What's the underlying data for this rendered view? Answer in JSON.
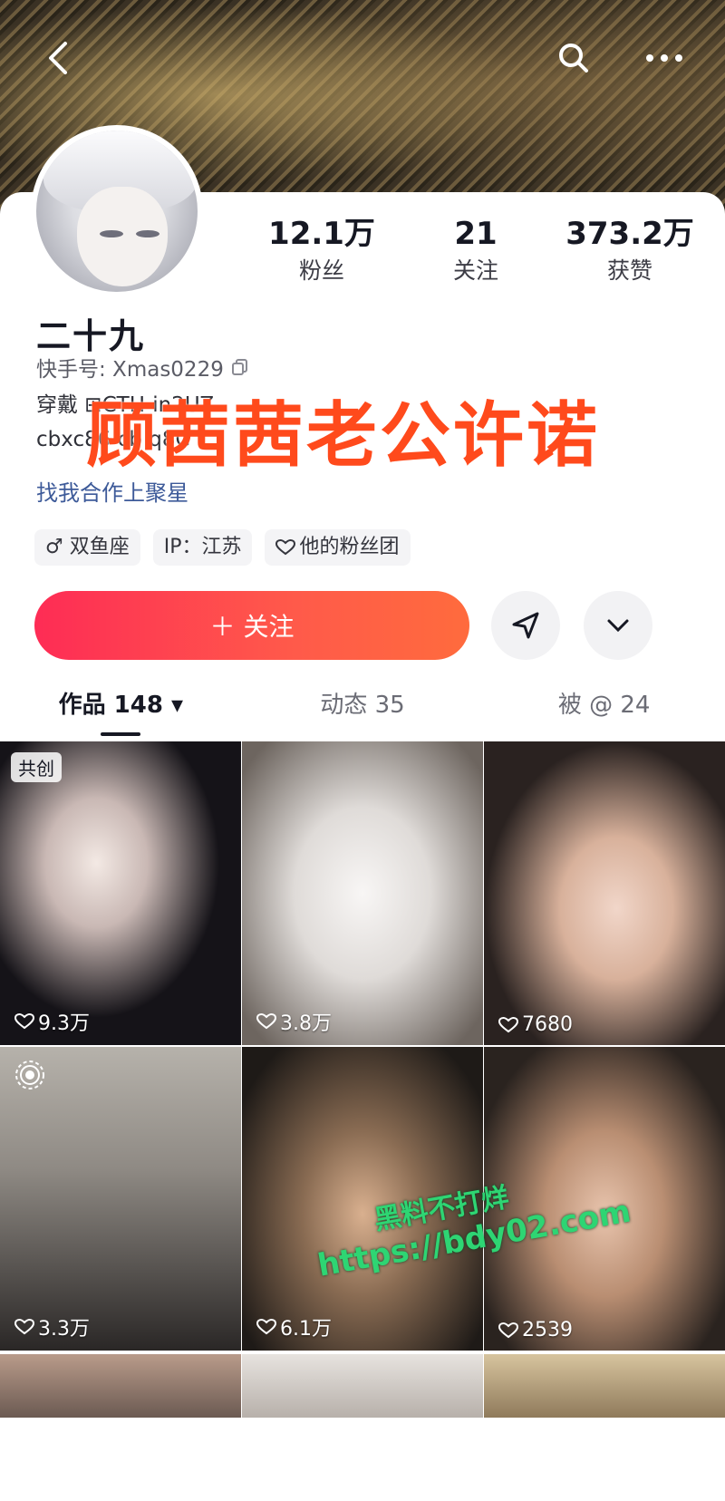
{
  "header": {
    "back_icon": "back-arrow-icon",
    "search_icon": "search-icon",
    "more_icon": "more-dots-icon"
  },
  "profile": {
    "stats": [
      {
        "value": "12.1万",
        "label": "粉丝"
      },
      {
        "value": "21",
        "label": "关注"
      },
      {
        "value": "373.2万",
        "label": "获赞"
      }
    ],
    "nickname": "二十九",
    "account_label": "快手号: Xmas0229",
    "bio_line1": "穿戴 ⊞CTH-in2UZ",
    "bio_line2": "cbxc86 cb q8C",
    "bio_link": "找我合作上聚星",
    "overlay_caption": "顾茜茜老公许诺",
    "tags": [
      "♂ 双鱼座",
      "IP：江苏",
      "他的粉丝团"
    ]
  },
  "actions": {
    "follow_label": "＋ 关注",
    "accent": "#fe2c55"
  },
  "tabs": [
    {
      "label": "作品 148 ▾",
      "active": true
    },
    {
      "label": "动态 35",
      "active": false
    },
    {
      "label": "被 @ 24",
      "active": false
    }
  ],
  "grid": [
    {
      "likes": "9.3万",
      "badge": "共创"
    },
    {
      "likes": "3.8万"
    },
    {
      "likes": "7680"
    },
    {
      "likes": "3.3万"
    },
    {
      "likes": "6.1万"
    },
    {
      "likes": "2539"
    }
  ],
  "watermark": {
    "line1": "黑料不打烊",
    "line2": "https://bdy02.com"
  }
}
